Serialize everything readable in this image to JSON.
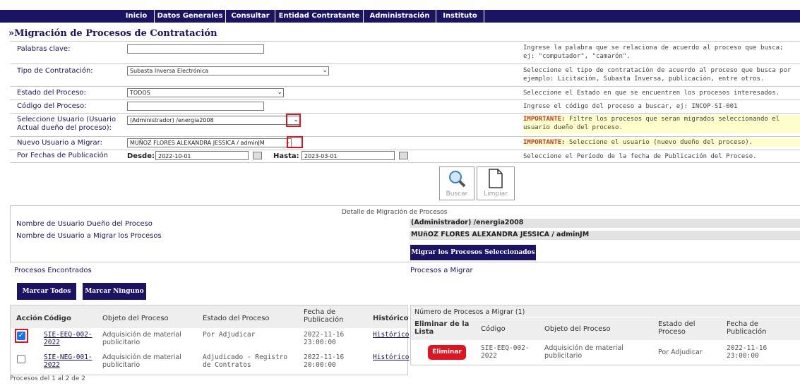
{
  "nav": [
    "Inicio",
    "Datos Generales",
    "Consultar",
    "Entidad Contratante",
    "Administración",
    "Instituto"
  ],
  "page_title": "»Migración de Procesos de Contratación",
  "form": {
    "keywords_label": "Palabras clave:",
    "keywords_value": "",
    "keywords_help": "Ingrese la palabra que se relaciona de acuerdo al proceso que busca; ej: \"computador\", \"camarón\".",
    "tipo_label": "Tipo de Contratación:",
    "tipo_value": "Subasta Inversa Electrónica",
    "tipo_help": "Seleccione el tipo de contratación de acuerdo al proceso que busca por ejemplo: Licitación, Subasta Inversa, publicación, entre otros.",
    "estado_label": "Estado del Proceso:",
    "estado_value": "TODOS",
    "estado_help": "Seleccione el Estado en que se encuentren los procesos interesados.",
    "codigo_label": "Código del Proceso:",
    "codigo_value": "",
    "codigo_help": "Ingrese el código del proceso a buscar, ej: INCOP-SI-001",
    "usuario_label": "Seleccione Usuario (Usuario Actual dueño del proceso):",
    "usuario_value": "(Administrador) /energia2008",
    "usuario_help_strong": "IMPORTANTE:",
    "usuario_help": "Filtre los procesos que seran migrados seleccionando el usuario dueño del proceso.",
    "nuevo_label": "Nuevo Usuario a Migrar:",
    "nuevo_value": "MUÑOZ FLORES ALEXANDRA JESSICA / adminJM",
    "nuevo_help_strong": "IMPORTANTE:",
    "nuevo_help": "Seleccione el usuario (nuevo dueño del proceso).",
    "fechas_label": "Por Fechas de Publicación",
    "desde_label": "Desde:",
    "desde_value": "2022-10-01",
    "hasta_label": "Hasta:",
    "hasta_value": "2023-03-01",
    "fechas_help": "Seleccione el Período de la fecha de Publicación del Proceso."
  },
  "actions": {
    "buscar": "Buscar",
    "limpiar": "Limpiar"
  },
  "detalle": {
    "title": "Detalle de Migración de Procesos",
    "dueno_label": "Nombre de Usuario Dueño del Proceso",
    "dueno_value": "(Administrador) /energia2008",
    "migrar_label": "Nombre de Usuario a Migrar los Procesos",
    "migrar_value": "MUñOZ FLORES ALEXANDRA JESSICA / adminJM",
    "migrar_button": "Migrar los Procesos Seleccionados"
  },
  "encontrados": {
    "title": "Procesos Encontrados",
    "marcar_todos": "Marcar Todos",
    "marcar_ninguno": "Marcar Ninguno",
    "headers": [
      "Acción",
      "Código",
      "Objeto del Proceso",
      "Estado del Proceso",
      "Fecha de Publicación",
      "Histórico"
    ],
    "rows": [
      {
        "checked": true,
        "codigo": "SIE-EEQ-002-2022",
        "objeto": "Adquisición de material publicitario",
        "estado": "Por Adjudicar",
        "fecha": "2022-11-16 23:00:00",
        "historico": "Histórico"
      },
      {
        "checked": false,
        "codigo": "SIE-NEG-001-2022",
        "objeto": "Adquisición de material publicitario",
        "estado": "Adjudicado - Registro de Contratos",
        "fecha": "2022-11-16 20:00:00",
        "historico": "Histórico"
      }
    ],
    "footer": "Procesos del 1 al 2 de 2"
  },
  "a_migrar": {
    "title": "Procesos a Migrar",
    "count_label": "Número de Procesos a Migrar (1)",
    "headers": [
      "Eliminar de la Lista",
      "Código",
      "Objeto del Proceso",
      "Estado del Proceso",
      "Fecha de Publicación"
    ],
    "rows": [
      {
        "eliminar": "Eliminar",
        "codigo": "SIE-EEQ-002-2022",
        "objeto": "Adquisición de material publicitario",
        "estado": "Por Adjudicar",
        "fecha": "2022-11-16 23:00:00"
      }
    ]
  },
  "colors": {
    "navy": "#1b1464",
    "red": "#e0141e",
    "highlight": "#ffffcc"
  }
}
